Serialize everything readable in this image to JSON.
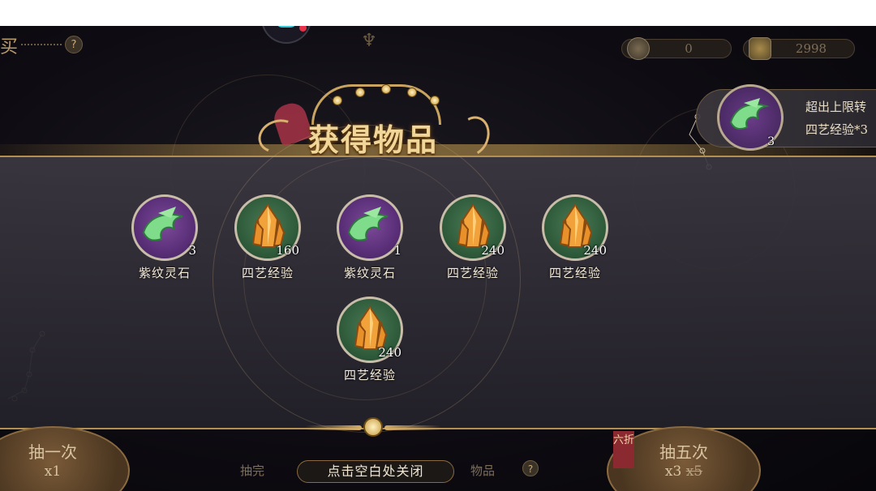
{
  "top_bar": {
    "left_label": "买",
    "help_symbol": "?",
    "currency_jade": "0",
    "currency_gold": "2998"
  },
  "title": "获得物品",
  "overflow_notice": {
    "line1": "超出上限转",
    "line2": "四艺经验*3",
    "icon": "jade-stone-icon",
    "count": "3"
  },
  "items": [
    {
      "name": "紫纹灵石",
      "count": "3",
      "icon": "jade-stone-icon",
      "bg": "purple"
    },
    {
      "name": "四艺经验",
      "count": "160",
      "icon": "gold-crystal-icon",
      "bg": "green"
    },
    {
      "name": "紫纹灵石",
      "count": "1",
      "icon": "jade-stone-icon",
      "bg": "purple"
    },
    {
      "name": "四艺经验",
      "count": "240",
      "icon": "gold-crystal-icon",
      "bg": "green"
    },
    {
      "name": "四艺经验",
      "count": "240",
      "icon": "gold-crystal-icon",
      "bg": "green"
    },
    {
      "name": "四艺经验",
      "count": "240",
      "icon": "gold-crystal-icon",
      "bg": "green"
    }
  ],
  "bottom": {
    "draw_one_label": "抽一次",
    "draw_one_cost": "x1",
    "draw_five_label": "抽五次",
    "draw_five_cost": "x3",
    "draw_five_old_cost": "x5",
    "discount_tag": "六折",
    "hint_left": "抽完",
    "hint_right": "物品",
    "close_hint": "点击空白处关闭",
    "help_symbol": "?"
  },
  "colors": {
    "gold_accent": "#d6b06a",
    "title_text": "#f1d69a",
    "panel_top": "#3c3842",
    "panel_bottom": "#222028",
    "item_purple": "#5a2f78",
    "item_green": "#2e5a3a",
    "discount_red": "#8a2a30"
  }
}
